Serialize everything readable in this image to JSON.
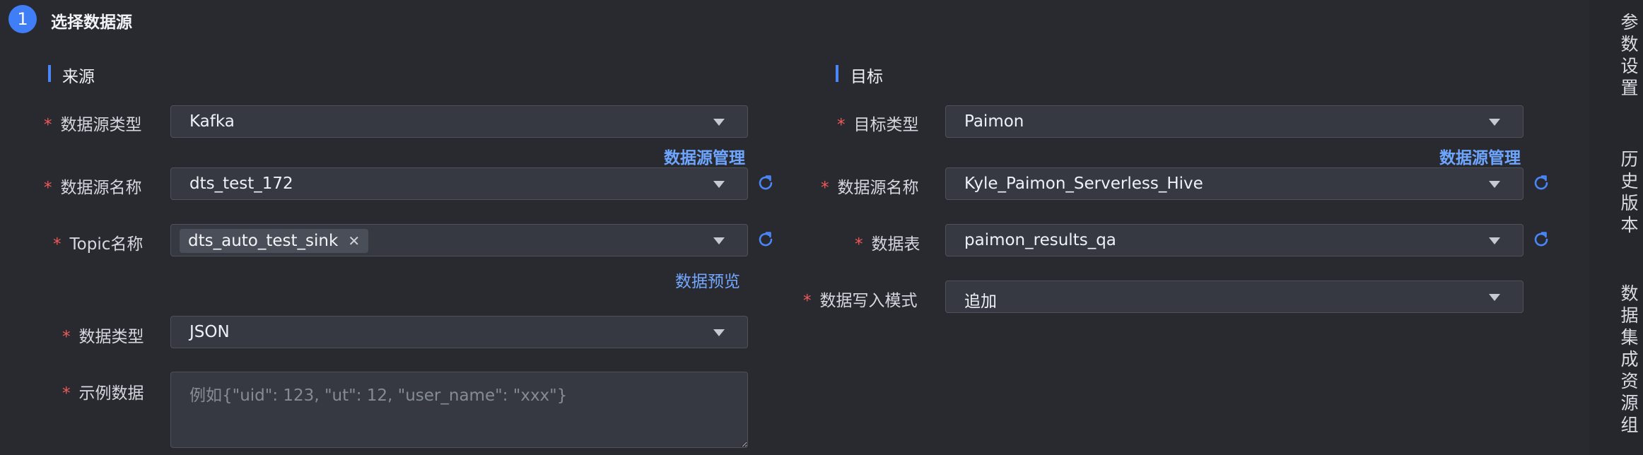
{
  "step": {
    "number": "1",
    "title": "选择数据源"
  },
  "source": {
    "section_title": "来源",
    "type_label": "数据源类型",
    "type_value": "Kafka",
    "manage_link": "数据源管理",
    "name_label": "数据源名称",
    "name_value": "dts_test_172",
    "topic_label": "Topic名称",
    "topic_tag": "dts_auto_test_sink",
    "preview_link": "数据预览",
    "data_type_label": "数据类型",
    "data_type_value": "JSON",
    "example_label": "示例数据",
    "example_placeholder": "例如{\"uid\": 123, \"ut\": 12, \"user_name\": \"xxx\"}"
  },
  "target": {
    "section_title": "目标",
    "type_label": "目标类型",
    "type_value": "Paimon",
    "manage_link": "数据源管理",
    "name_label": "数据源名称",
    "name_value": "Kyle_Paimon_Serverless_Hive",
    "table_label": "数据表",
    "table_value": "paimon_results_qa",
    "mode_label": "数据写入模式",
    "mode_value": "追加"
  },
  "required_mark": "*",
  "right_rail": [
    "参数设置",
    "历史版本",
    "数据集成资源组"
  ],
  "colors": {
    "accent": "#3f7ef7",
    "link": "#6ea6ff",
    "required": "#f15959",
    "background": "#282a30"
  }
}
